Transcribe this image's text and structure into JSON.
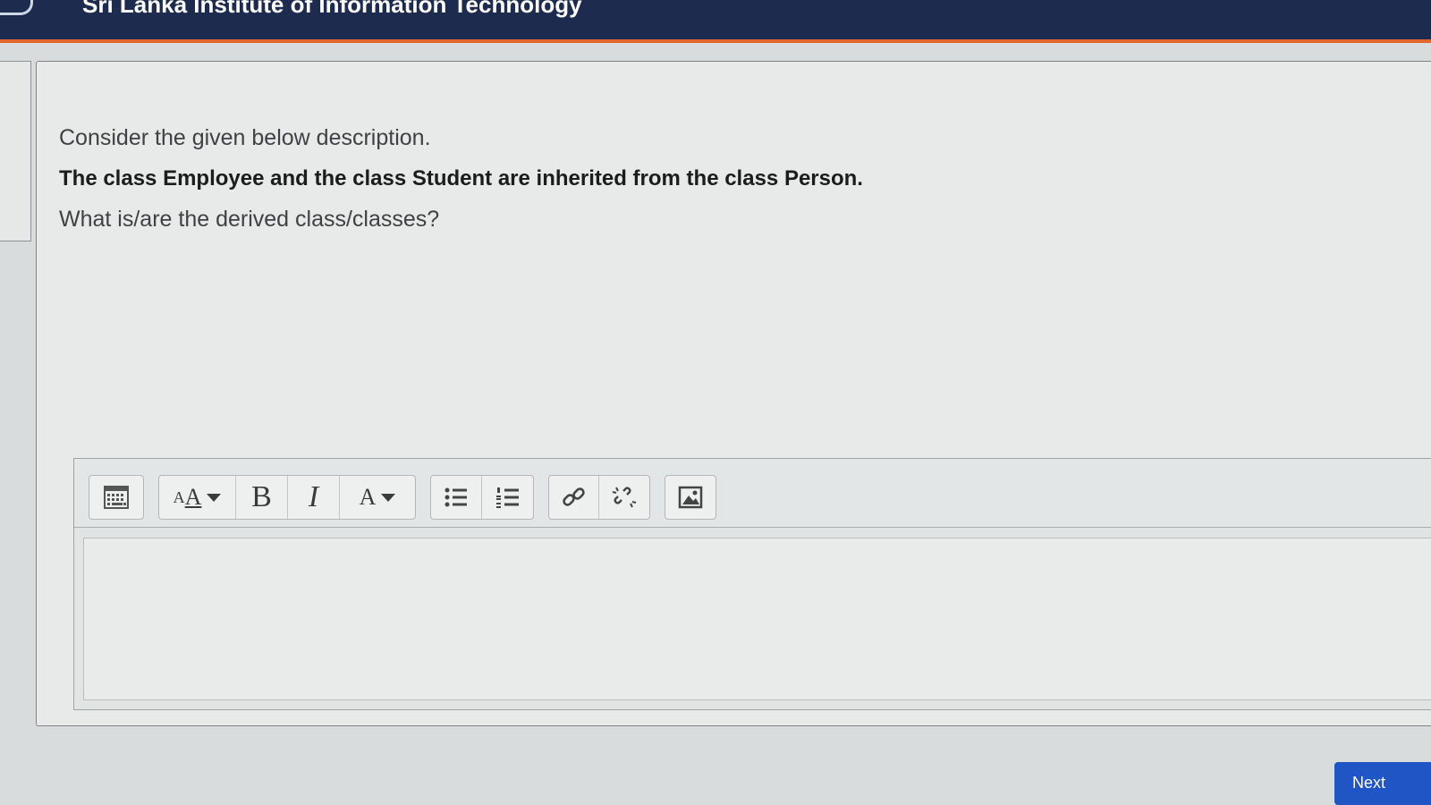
{
  "header": {
    "title": "Sri Lanka Institute of Information Technology"
  },
  "question": {
    "line1": "Consider the given below description.",
    "line2": "The class Employee and the class Student are inherited from the class Person.",
    "line3": "What is/are the derived class/classes?"
  },
  "toolbar": {
    "font_size_label": "A",
    "bold_label": "B",
    "italic_label": "I",
    "font_color_label": "A",
    "icons": [
      "show-more-icon",
      "font-size-icon",
      "bold-icon",
      "italic-icon",
      "font-color-icon",
      "unordered-list-icon",
      "ordered-list-icon",
      "link-icon",
      "unlink-icon",
      "image-icon"
    ]
  },
  "editor": {
    "value": ""
  },
  "footer": {
    "next_label": "Next"
  },
  "colors": {
    "header_bg": "#1d2b4f",
    "header_accent": "#e0662c",
    "next_button": "#1f55c4"
  }
}
